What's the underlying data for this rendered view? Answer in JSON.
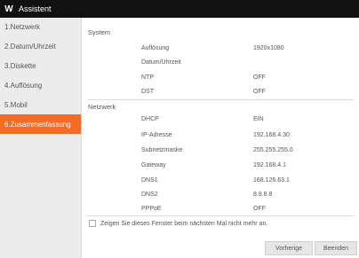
{
  "titlebar": {
    "logo": "W",
    "title": "Assistent"
  },
  "sidebar": {
    "items": [
      {
        "label": "1.Netzwerk"
      },
      {
        "label": "2.Datum/Uhrzeit"
      },
      {
        "label": "3.Diskette"
      },
      {
        "label": "4.Auflösung"
      },
      {
        "label": "5.Mobil"
      },
      {
        "label": "6.Zusammenfassung",
        "active": true
      }
    ]
  },
  "system": {
    "heading": "System",
    "rows": [
      {
        "label": "Auflösung",
        "value": "1920x1080"
      },
      {
        "label": "Datum/Uhrzeit",
        "value": ""
      },
      {
        "label": "NTP",
        "value": "OFF"
      },
      {
        "label": "DST",
        "value": "OFF"
      }
    ]
  },
  "netzwerk": {
    "heading": "Netzwerk",
    "rows": [
      {
        "label": "DHCP",
        "value": "EIN"
      },
      {
        "label": "IP-Adresse",
        "value": "192.168.4.30"
      },
      {
        "label": "Subnetzmaske",
        "value": "255.255.255.0"
      },
      {
        "label": "Gateway",
        "value": "192.168.4.1"
      },
      {
        "label": "DNS1",
        "value": "168.126.63.1"
      },
      {
        "label": "DNS2",
        "value": "8.8.8.8"
      },
      {
        "label": "PPPoE",
        "value": "OFF"
      }
    ]
  },
  "checkbox": {
    "label": "Zeigen Sie dieses Fenster beim nächsten Mal nicht mehr an.",
    "checked": false
  },
  "buttons": {
    "prev": "Vorherige",
    "end": "Beenden"
  },
  "colors": {
    "accent": "#f36b24",
    "titlebar": "#111111"
  }
}
